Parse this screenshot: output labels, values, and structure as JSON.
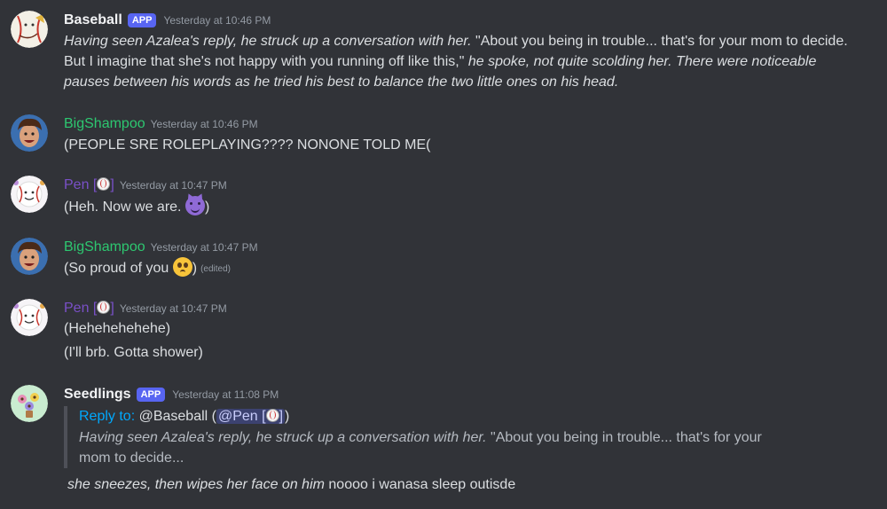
{
  "messages": [
    {
      "author": "Baseball",
      "badge": "APP",
      "timestamp": "Yesterday at 10:46 PM",
      "lines": [
        {
          "italic": "Having seen Azalea's reply, he struck up a conversation with her.",
          "plain": " \"About you being in trouble... that's for your mom to decide.",
          "italic2": ""
        },
        {
          "italic": "",
          "plain": "But I imagine that she's not happy with you running off like this,\"",
          "italic2": " he spoke, not quite scolding her. There were noticeable"
        },
        {
          "italic": "pauses between his words as he tried his best to balance the two little ones on his head.",
          "plain": "",
          "italic2": ""
        }
      ]
    },
    {
      "author": "BigShampoo",
      "timestamp": "Yesterday at 10:46 PM",
      "text": "(PEOPLE SRE ROLEPLAYING???? NONONE TOLD ME("
    },
    {
      "author": "Pen",
      "tag": "[",
      "tag_end": "]",
      "timestamp": "Yesterday at 10:47 PM",
      "text_before": "(Heh. Now we are. ",
      "text_after": ")",
      "emoji": "smiling-devil-emoji"
    },
    {
      "author": "BigShampoo",
      "timestamp": "Yesterday at 10:47 PM",
      "text_before": "(So proud of you ",
      "text_after": ")",
      "emoji": "pleading-face-emoji",
      "edited": "(edited)"
    },
    {
      "author": "Pen",
      "tag": "[",
      "tag_end": "]",
      "timestamp": "Yesterday at 10:47 PM",
      "line1": "(Hehehehehehe)",
      "line2": "(I'll brb. Gotta shower)"
    },
    {
      "author": "Seedlings",
      "badge": "APP",
      "timestamp": "Yesterday at 11:08 PM",
      "reply": {
        "label": "Reply to:",
        "target": " @Baseball (",
        "mention": "@Pen [",
        "mention_end": "]",
        "close": ")",
        "body_italic": "Having seen Azalea's reply, he struck up a conversation with her.",
        "body_plain": " \"About you being in trouble... that's for your",
        "body_line2": "mom to decide..."
      },
      "text_italic": "she sneezes, then wipes her face on him",
      "text_plain": " noooo i wanasa sleep outisde"
    }
  ],
  "colors": {
    "background": "#313338",
    "app_badge": "#5865f2",
    "green_name": "#2dc770",
    "purple_name": "#7a50c8",
    "reply_link": "#00a8fc"
  }
}
